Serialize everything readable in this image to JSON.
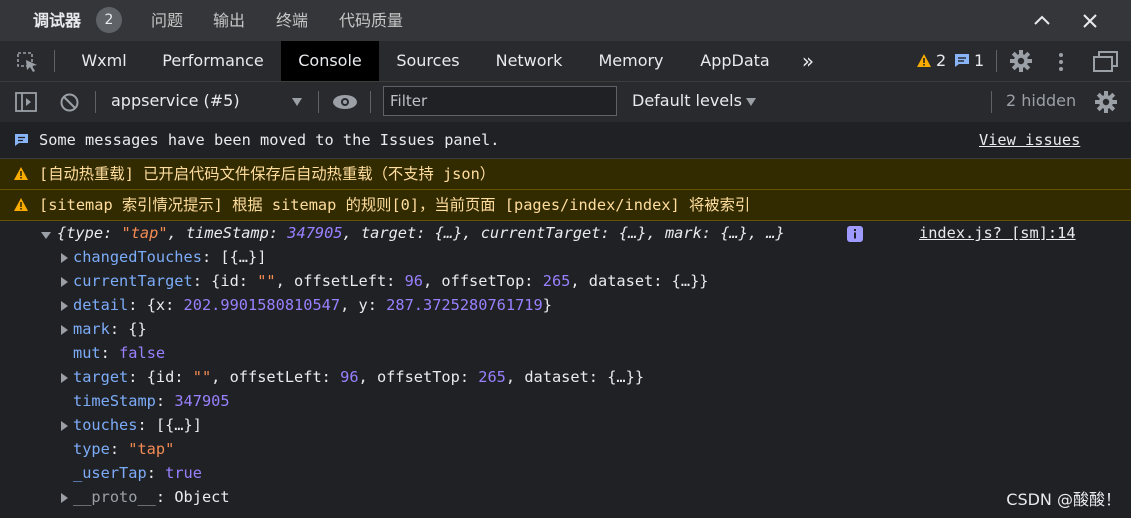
{
  "top_tabs": [
    "调试器",
    "问题",
    "输出",
    "终端",
    "代码质量"
  ],
  "debugger_badge": "2",
  "tabs": [
    "Wxml",
    "Performance",
    "Console",
    "Sources",
    "Network",
    "Memory",
    "AppData"
  ],
  "more_tabs": "»",
  "counts": {
    "warnings": "2",
    "messages": "1"
  },
  "toolbar": {
    "context": "appservice (#5)",
    "filter_placeholder": "Filter",
    "levels": "Default levels",
    "hidden": "2 hidden"
  },
  "messages": {
    "info": "Some messages have been moved to the Issues panel.",
    "view_issues": "View issues",
    "warn1": "[自动热重载] 已开启代码文件保存后自动热重载（不支持 json）",
    "warn2": "[sitemap 索引情况提示] 根据 sitemap 的规则[0]，当前页面 [pages/index/index] 将被索引"
  },
  "object": {
    "source_link": "index.js? [sm]:14",
    "summary": {
      "open": "{",
      "k1": "type",
      "v1": "\"tap\"",
      "k2": "timeStamp",
      "v2": "347905",
      "k3": "target",
      "v3": "{…}",
      "k4": "currentTarget",
      "v4": "{…}",
      "k5": "mark",
      "v5": "{…}",
      "tail": ", …}"
    },
    "props": {
      "changedTouches": {
        "key": "changedTouches",
        "value": "[{…}]"
      },
      "currentTarget": {
        "key": "currentTarget",
        "p1": "{id: ",
        "id": "\"\"",
        "p2": ", offsetLeft: ",
        "left": "96",
        "p3": ", offsetTop: ",
        "top": "265",
        "p4": ", dataset: {…}}"
      },
      "detail": {
        "key": "detail",
        "p1": "{x: ",
        "x": "202.9901580810547",
        "p2": ", y: ",
        "y": "287.3725280761719",
        "p3": "}"
      },
      "mark": {
        "key": "mark",
        "value": "{}"
      },
      "mut": {
        "key": "mut",
        "value": "false"
      },
      "target": {
        "key": "target",
        "p1": "{id: ",
        "id": "\"\"",
        "p2": ", offsetLeft: ",
        "left": "96",
        "p3": ", offsetTop: ",
        "top": "265",
        "p4": ", dataset: {…}}"
      },
      "timeStamp": {
        "key": "timeStamp",
        "value": "347905"
      },
      "touches": {
        "key": "touches",
        "value": "[{…}]"
      },
      "type": {
        "key": "type",
        "value": "\"tap\""
      },
      "userTap": {
        "key": "_userTap",
        "value": "true"
      },
      "proto": {
        "key": "__proto__",
        "value": "Object"
      }
    }
  },
  "watermark": "CSDN @酸酸！",
  "colors": {
    "warning": "#f9ab00",
    "info": "#8ab4f8",
    "active_tab": "#000000"
  }
}
